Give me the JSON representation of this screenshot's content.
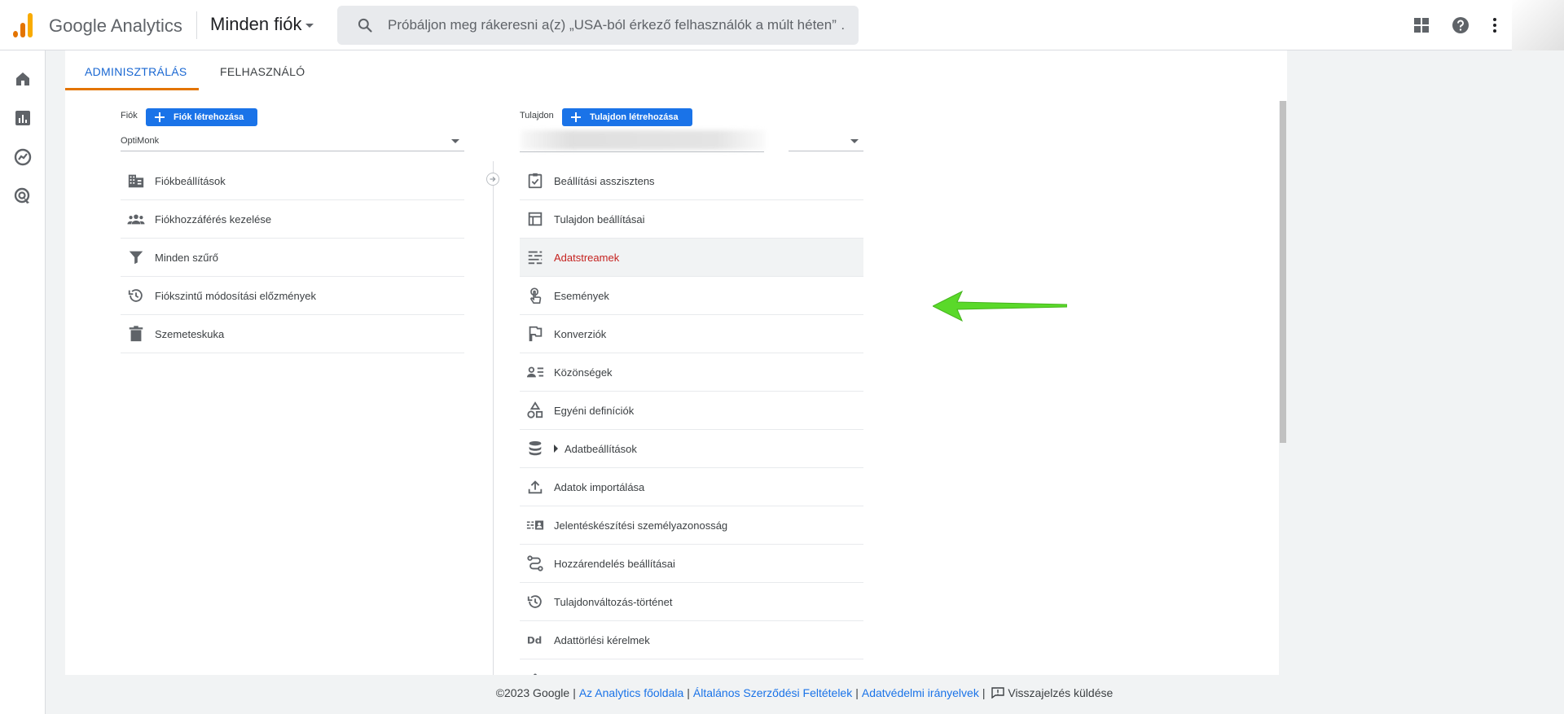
{
  "header": {
    "app_name": "Google Analytics",
    "account_selector": "Minden fiók",
    "search_placeholder": "Próbáljon meg rákeresni a(z) „USA-ból érkező felhasználók a múlt héten” …"
  },
  "tabs": [
    {
      "label": "ADMINISZTRÁLÁS",
      "active": true
    },
    {
      "label": "FELHASZNÁLÓ",
      "active": false
    }
  ],
  "account_column": {
    "label": "Fiók",
    "create_button": "Fiók létrehozása",
    "selected": "OptiMonk",
    "items": [
      {
        "label": "Fiókbeállítások",
        "icon": "building-icon"
      },
      {
        "label": "Fiókhozzáférés kezelése",
        "icon": "people-icon"
      },
      {
        "label": "Minden szűrő",
        "icon": "filter-icon"
      },
      {
        "label": "Fiókszintű módosítási előzmények",
        "icon": "history-icon"
      },
      {
        "label": "Szemeteskuka",
        "icon": "trash-icon"
      }
    ]
  },
  "property_column": {
    "label": "Tulajdon",
    "create_button": "Tulajdon létrehozása",
    "items": [
      {
        "label": "Beállítási asszisztens",
        "icon": "checklist-icon"
      },
      {
        "label": "Tulajdon beállításai",
        "icon": "property-layout-icon"
      },
      {
        "label": "Adatstreamek",
        "icon": "data-streams-icon",
        "selected": true
      },
      {
        "label": "Események",
        "icon": "touch-icon"
      },
      {
        "label": "Konverziók",
        "icon": "flag-icon"
      },
      {
        "label": "Közönségek",
        "icon": "audience-icon"
      },
      {
        "label": "Egyéni definíciók",
        "icon": "shapes-icon"
      },
      {
        "label": "Adatbeállítások",
        "icon": "database-icon",
        "expandable": true
      },
      {
        "label": "Adatok importálása",
        "icon": "upload-icon"
      },
      {
        "label": "Jelentéskészítési személyazonosság",
        "icon": "identity-icon"
      },
      {
        "label": "Hozzárendelés beállításai",
        "icon": "attribution-icon"
      },
      {
        "label": "Tulajdonváltozás-történet",
        "icon": "history-icon"
      },
      {
        "label": "Adattörlési kérelmek",
        "icon": "dd-icon"
      }
    ]
  },
  "footer": {
    "copyright": "©2023 Google",
    "link_home": "Az Analytics főoldala",
    "link_terms": "Általános Szerződési Feltételek",
    "link_privacy": "Adatvédelmi irányelvek",
    "feedback": "Visszajelzés küldése"
  },
  "colors": {
    "accent_blue": "#1a73e8",
    "active_tab": "#1967d2",
    "tab_underline": "#e37400",
    "selected_item_text": "#c5221f",
    "annotation_arrow": "#5ad92a"
  }
}
